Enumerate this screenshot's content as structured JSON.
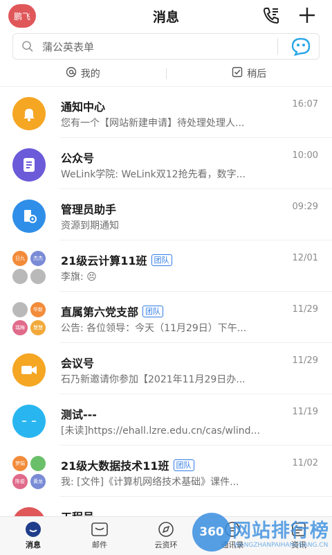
{
  "header": {
    "avatar_text": "鹏飞",
    "title": "消息",
    "icons": [
      "contacts-phone-icon",
      "plus-icon"
    ]
  },
  "search": {
    "placeholder": "蒲公英表单",
    "bot_icon": "assistant-bot-icon"
  },
  "filters": [
    {
      "label": "我的",
      "icon": "at-icon"
    },
    {
      "label": "稍后",
      "icon": "checkbox-icon"
    }
  ],
  "conversations": [
    {
      "name": "通知中心",
      "preview": "您有一个【网站新建申请】待处理处理人...",
      "time": "16:07",
      "badge": "",
      "avatar_color": "#f5a623",
      "icon": "bell-icon"
    },
    {
      "name": "公众号",
      "preview": "WeLink学院: WeLink双12抢先看，数字...",
      "time": "10:00",
      "badge": "",
      "avatar_color": "#6b5bd9",
      "icon": "document-icon"
    },
    {
      "name": "管理员助手",
      "preview": "资源到期通知",
      "time": "09:29",
      "badge": "",
      "avatar_color": "#2f8fe8",
      "icon": "admin-icon"
    },
    {
      "name": "21级云计算11班",
      "preview": "李旗: 😣",
      "time": "12/01",
      "badge": "团队",
      "group": [
        "日九",
        "杰杰",
        "",
        ""
      ]
    },
    {
      "name": "直属第六党支部",
      "preview": "公告: 各位领导：今天（11月29日）下午...",
      "time": "11/29",
      "badge": "团队",
      "group": [
        "",
        "华新",
        "瑞梅",
        "慧慧"
      ]
    },
    {
      "name": "会议号",
      "preview": "石乃新邀请你参加【2021年11月29日办...",
      "time": "11/29",
      "badge": "",
      "avatar_color": "#f5a623",
      "icon": "video-camera-icon"
    },
    {
      "name": "测试---",
      "preview": "[未读]https://ehall.lzre.edu.cn/cas/wlind...",
      "time": "11/19",
      "badge": "",
      "avatar_color": "#29b6f0",
      "icon": "emoji-face-icon"
    },
    {
      "name": "21级大数据技术11班",
      "preview": "我: [文件]《计算机网络技术基础》课件...",
      "time": "11/02",
      "badge": "团队",
      "group": [
        "梦娟",
        "",
        "陈俊",
        "黄龙"
      ]
    },
    {
      "name": "工程号",
      "preview": "",
      "time": "",
      "badge": "",
      "avatar_color": "#e0575a",
      "icon": "gear-icon"
    }
  ],
  "tabs": [
    {
      "label": "消息",
      "icon": "message-icon",
      "active": true
    },
    {
      "label": "邮件",
      "icon": "mail-icon"
    },
    {
      "label": "云资环",
      "icon": "compass-icon"
    },
    {
      "label": "通讯录",
      "icon": "contacts-icon"
    },
    {
      "label": "资讯",
      "icon": "news-icon"
    }
  ],
  "watermark": {
    "badge": "360",
    "text": "网站排行榜",
    "sub": "WANGZHANPAIHANGBANG.CN"
  },
  "colors": {
    "accent": "#2f7be5",
    "notice": "#f5a623",
    "public": "#6b5bd9",
    "admin": "#2f8fe8"
  }
}
